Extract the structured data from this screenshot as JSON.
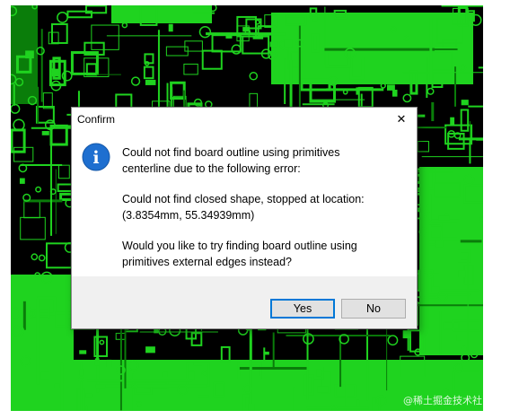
{
  "dialog": {
    "title": "Confirm",
    "close_glyph": "✕",
    "icon": "info-icon",
    "icon_glyph": "i",
    "line1a": "Could not find board outline using primitives",
    "line1b": "centerline due to the following error:",
    "line2a": "Could not find closed shape, stopped at location:",
    "line2b": "(3.8354mm, 55.34939mm)",
    "line3a": "Would you like to try finding board outline using",
    "line3b": "primitives external edges instead?",
    "yes_label": "Yes",
    "no_label": "No"
  },
  "watermark": "@稀土掘金技术社区",
  "colors": {
    "pcb_green": "#1fd31f",
    "pcb_dark": "#0a7d0a",
    "dialog_accent": "#0078d7",
    "info_blue": "#1e6fd0"
  }
}
